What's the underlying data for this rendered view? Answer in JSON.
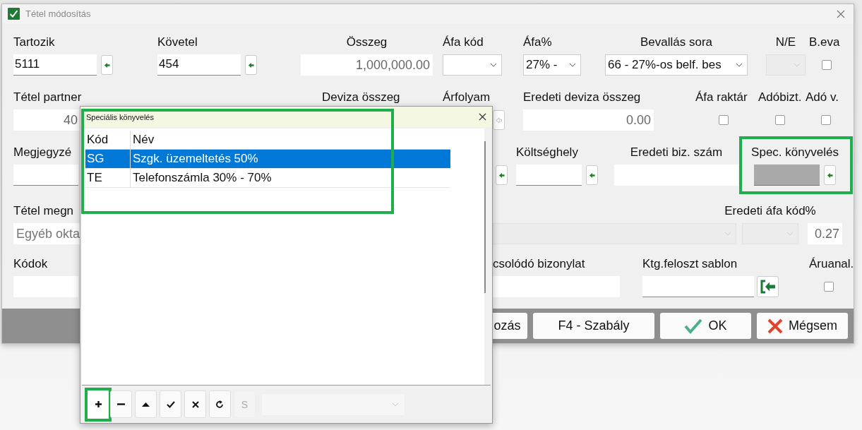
{
  "window": {
    "title": "Tétel módosítás"
  },
  "form_rows": [
    [
      {
        "label": "Tartozik",
        "kind": "lookup",
        "value": "5111",
        "disabled": false,
        "button_disabled": false
      },
      {
        "label": "Követel",
        "kind": "lookup",
        "value": "454",
        "disabled": false,
        "button_disabled": false
      },
      {
        "label": "Összeg",
        "kind": "readonly",
        "value": "1,000,000.00"
      },
      {
        "label": "Áfa kód",
        "kind": "select",
        "disabled": false
      },
      {
        "label": "Áfa%",
        "kind": "select",
        "value": "27%  -",
        "disabled": false
      },
      {
        "label": "Bevallás sora",
        "kind": "select",
        "value": "66 - 27%-os belf. bes",
        "disabled": false
      },
      {
        "label": "N/E",
        "kind": "select",
        "disabled": true
      },
      {
        "label": "B.eva",
        "kind": "checkbox",
        "checked": false
      }
    ],
    [
      {
        "label": "Tétel partner",
        "kind": "readonly",
        "value": "40"
      },
      {
        "label": "Deviza összeg",
        "kind": "label"
      },
      {
        "label": "Árfolyam",
        "kind": "lookup",
        "button_disabled": true
      },
      {
        "label": "Eredeti deviza összeg",
        "kind": "readonly",
        "value": "0.00"
      },
      {
        "label": "Áfa raktár",
        "kind": "checkbox",
        "checked": false
      },
      {
        "label": "Adóbizt.",
        "kind": "checkbox",
        "checked": false
      },
      {
        "label": "Adó v.",
        "kind": "checkbox",
        "checked": false
      }
    ],
    [
      {
        "label": "Megjegyzé",
        "kind": "lookup",
        "disabled": false,
        "button_disabled": false
      },
      {
        "label": "Költséghely",
        "kind": "lookup",
        "disabled": false,
        "button_disabled": false
      },
      {
        "label": "Eredeti biz. szám",
        "kind": "readonly"
      },
      {
        "label": "Spec. könyvelés",
        "kind": "lookup",
        "disabled": true,
        "button_disabled": false,
        "highlighted": true
      }
    ],
    [
      {
        "label": "Tétel megn",
        "kind": "note",
        "value": "Egyéb okta"
      },
      {
        "kind": "select",
        "disabled": true
      },
      {
        "label": "Eredeti áfa kód%",
        "kind": "select",
        "disabled": true
      },
      {
        "kind": "readonly",
        "value": "0.27"
      }
    ],
    [
      {
        "label": "Kódok",
        "kind": "readonly"
      },
      {
        "label": "csolódó bizonylat",
        "kind": "readonly"
      },
      {
        "label": "Ktg.feloszt sablon",
        "kind": "lookup-large",
        "disabled": false
      },
      {
        "label": "Áruanal.",
        "kind": "checkbox",
        "checked": false
      }
    ]
  ],
  "footer_buttons": [
    {
      "label": "ozás",
      "kind": "plain"
    },
    {
      "label": "F4 - Szabály",
      "kind": "plain"
    },
    {
      "label": "OK",
      "kind": "ok"
    },
    {
      "label": "Mégsem",
      "kind": "cancel"
    }
  ],
  "popup": {
    "title": "Speciális könyvelés",
    "grid_highlighted": true,
    "columns": [
      "Kód",
      "Név"
    ],
    "rows": [
      {
        "code": "SG",
        "name": "Szgk. üzemeltetés 50%",
        "selected": true
      },
      {
        "code": "TE",
        "name": "Telefonszámla 30% - 70%",
        "selected": false
      }
    ],
    "toolbar": [
      {
        "kind": "add",
        "disabled": false,
        "highlighted": true
      },
      {
        "kind": "remove",
        "disabled": false,
        "highlighted": false
      },
      {
        "kind": "up",
        "disabled": false,
        "highlighted": false
      },
      {
        "kind": "confirm",
        "disabled": false,
        "highlighted": false
      },
      {
        "kind": "cancel",
        "disabled": false,
        "highlighted": false
      },
      {
        "kind": "refresh",
        "disabled": false,
        "highlighted": false
      },
      {
        "kind": "letter",
        "label": "S",
        "disabled": true,
        "highlighted": false
      },
      {
        "kind": "select",
        "disabled": true,
        "highlighted": false
      }
    ]
  }
}
